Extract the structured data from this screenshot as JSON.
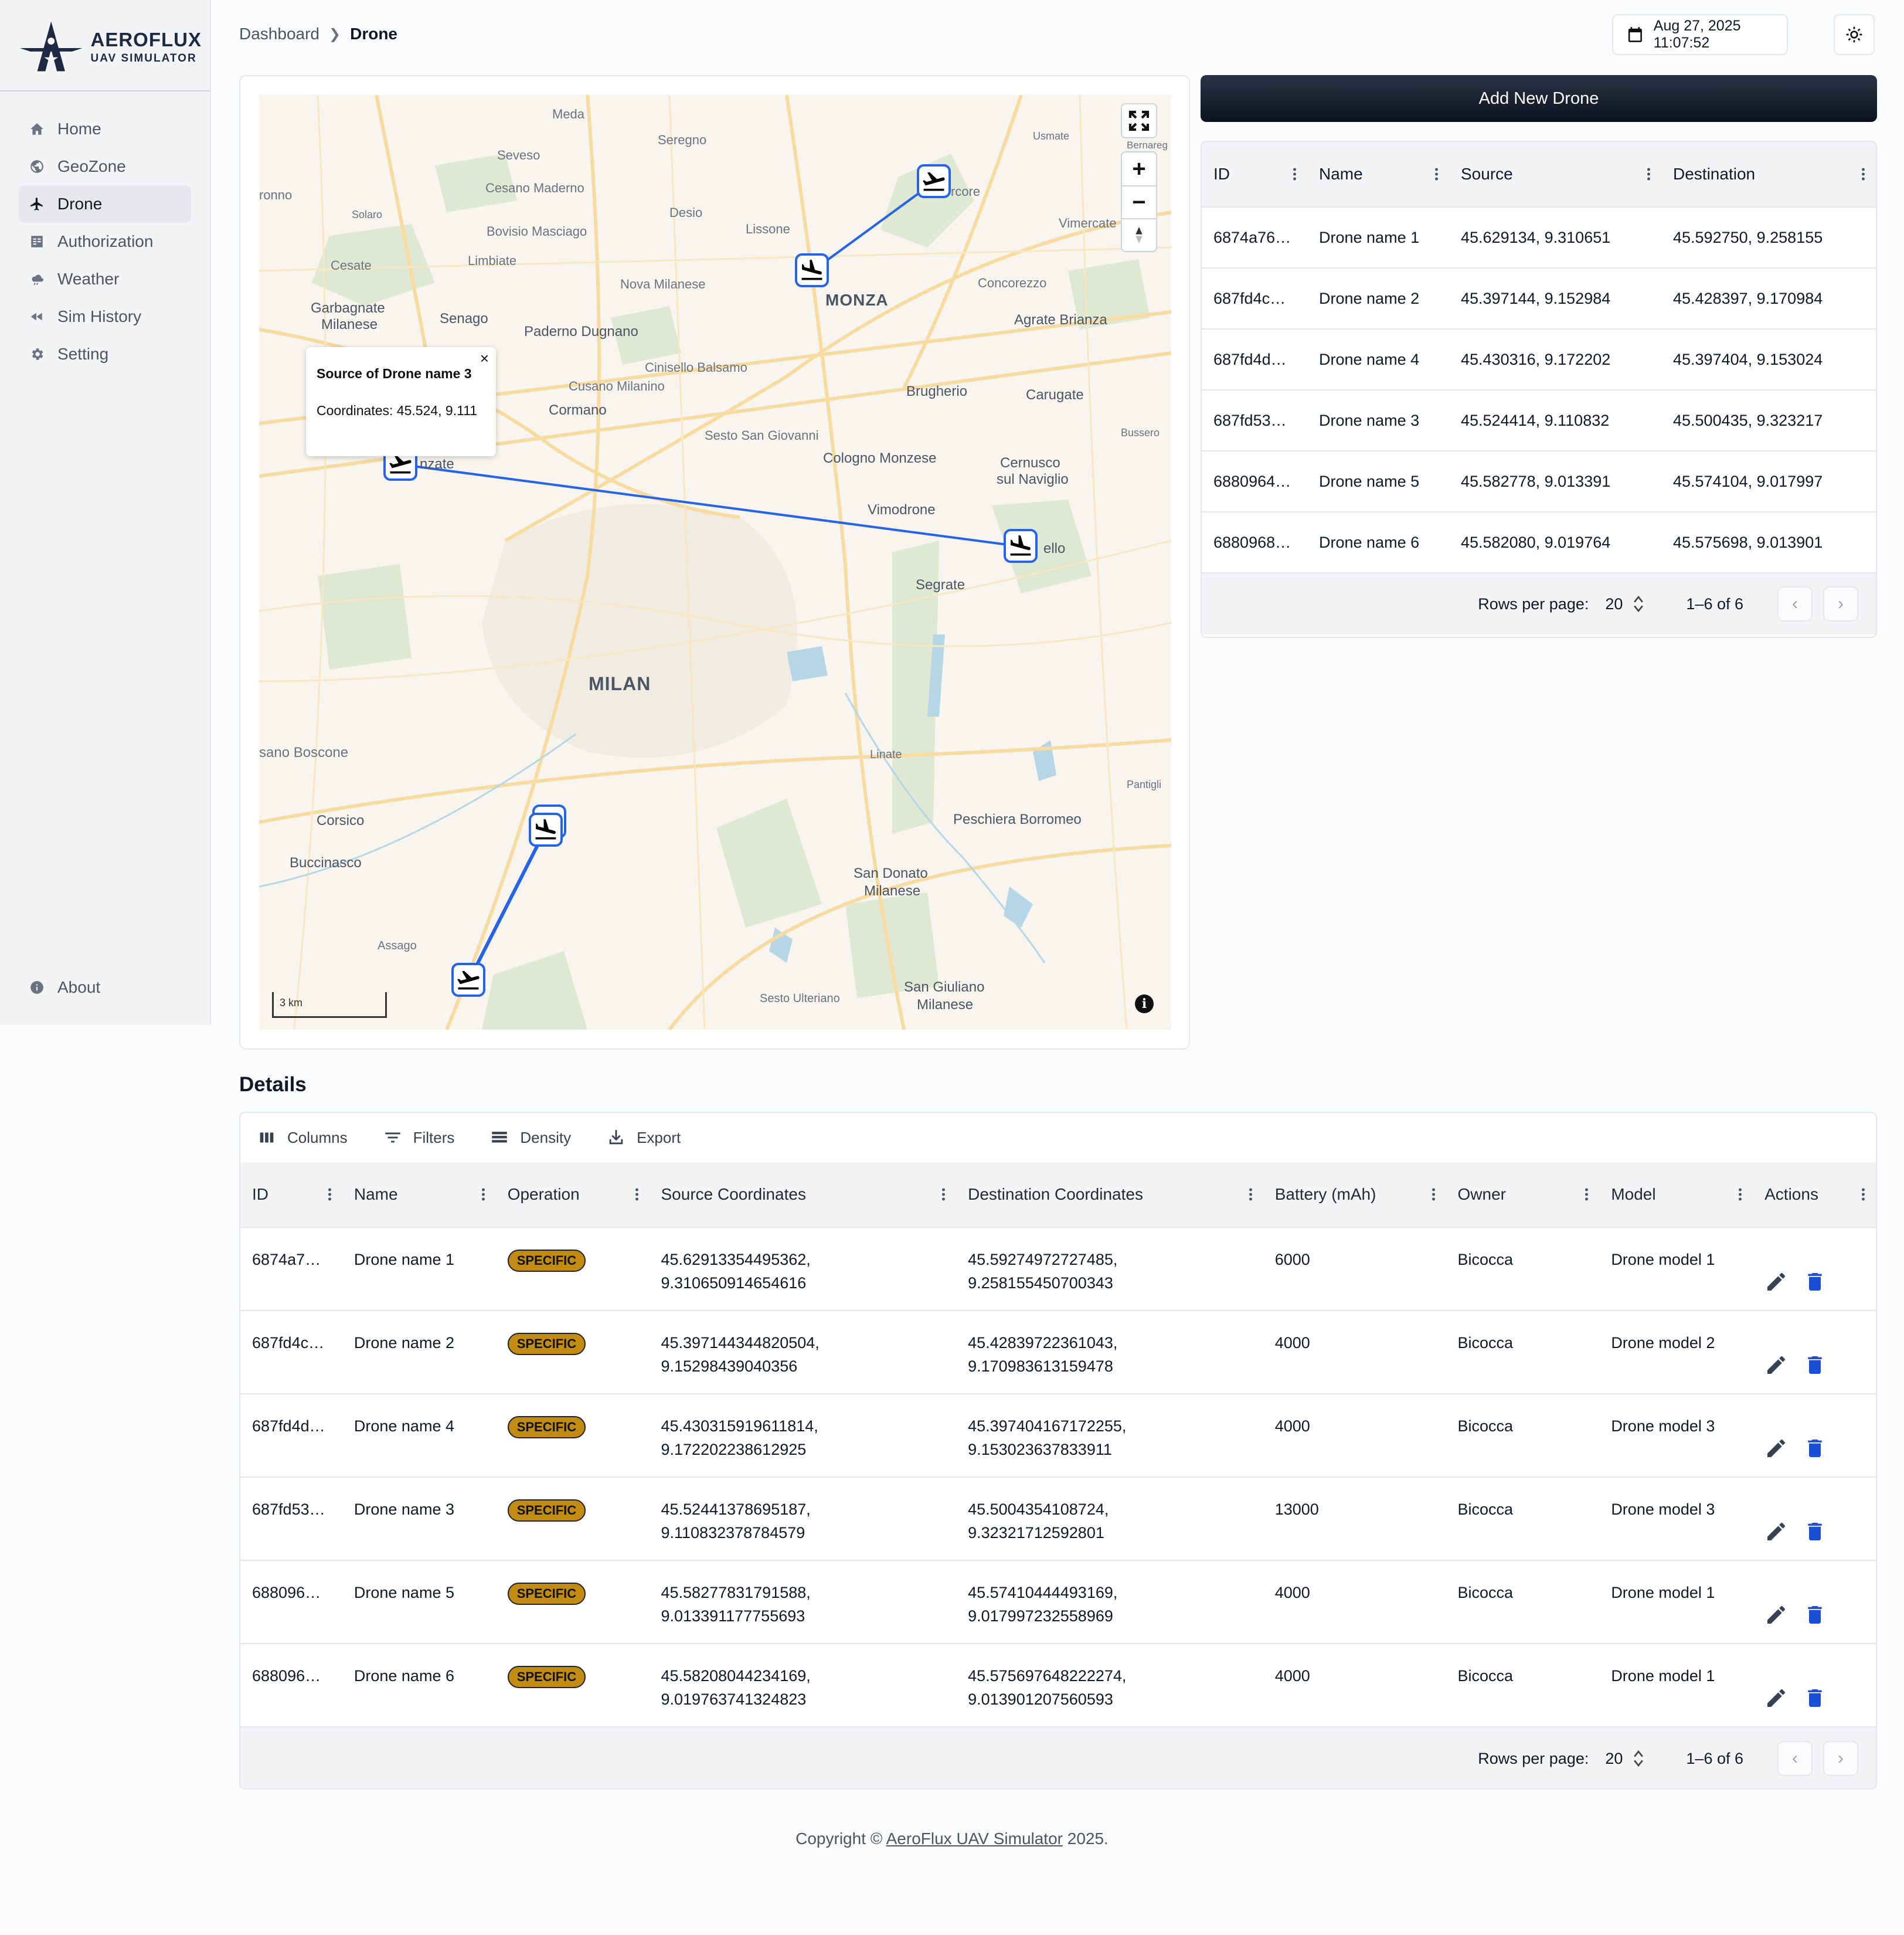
{
  "brand": {
    "name": "AEROFLUX",
    "subtitle": "UAV SIMULATOR"
  },
  "sidebar": {
    "items": [
      {
        "label": "Home",
        "icon": "home-icon"
      },
      {
        "label": "GeoZone",
        "icon": "globe-icon"
      },
      {
        "label": "Drone",
        "icon": "airplane-icon",
        "active": true
      },
      {
        "label": "Authorization",
        "icon": "clipboard-icon"
      },
      {
        "label": "Weather",
        "icon": "cloud-rain-icon"
      },
      {
        "label": "Sim History",
        "icon": "rewind-icon"
      },
      {
        "label": "Setting",
        "icon": "gear-icon"
      }
    ],
    "about": "About"
  },
  "header": {
    "breadcrumb": [
      "Dashboard",
      "Drone"
    ],
    "datetime": "Aug 27, 2025 11:07:52"
  },
  "map": {
    "places": [
      "Meda",
      "Seregno",
      "Usmate",
      "Seveso",
      "Bernareg",
      "ronno",
      "Cesano Maderno",
      "Desio",
      "rcore",
      "Solaro",
      "Bovisio Masciago",
      "Lissone",
      "Vimercate",
      "Limbiate",
      "Cesate",
      "Nova Milanese",
      "MONZA",
      "Concorezzo",
      "Garbagnate",
      "Milanese",
      "Senago",
      "Paderno Dugnano",
      "Agrate Brianza",
      "Cinisello Balsamo",
      "Cusano Milanino",
      "Brugherio",
      "Carugate",
      "Cormano",
      "Sesto San Giovanni",
      "Bussero",
      "nzate",
      "Cologno Monzese",
      "Cernusco",
      "sul Naviglio",
      "Vimodrone",
      "ello",
      "Segrate",
      "MILAN",
      "sano Boscone",
      "Linate",
      "Pantigli",
      "Corsico",
      "Peschiera Borromeo",
      "Buccinasco",
      "San Donato",
      "Milanese",
      "Assago",
      "Sesto Ulteriano",
      "San Giuliano",
      "Milanese"
    ],
    "popup": {
      "title": "Source of Drone name 3",
      "coordinates": "Coordinates: 45.524, 9.111",
      "close": "×"
    },
    "scale": "3 km",
    "info": "i",
    "accent": "#2563eb"
  },
  "add_button": "Add New Drone",
  "drone_table": {
    "columns": [
      "ID",
      "Name",
      "Source",
      "Destination"
    ],
    "rows": [
      [
        "6874a76…",
        "Drone name 1",
        "45.629134, 9.310651",
        "45.592750, 9.258155"
      ],
      [
        "687fd4c…",
        "Drone name 2",
        "45.397144, 9.152984",
        "45.428397, 9.170984"
      ],
      [
        "687fd4d…",
        "Drone name 4",
        "45.430316, 9.172202",
        "45.397404, 9.153024"
      ],
      [
        "687fd53…",
        "Drone name 3",
        "45.524414, 9.110832",
        "45.500435, 9.323217"
      ],
      [
        "6880964…",
        "Drone name 5",
        "45.582778, 9.013391",
        "45.574104, 9.017997"
      ],
      [
        "6880968…",
        "Drone name 6",
        "45.582080, 9.019764",
        "45.575698, 9.013901"
      ]
    ],
    "rows_per_page_label": "Rows per page:",
    "rows_per_page": "20",
    "range": "1–6 of 6"
  },
  "details": {
    "title": "Details",
    "toolbar": [
      "Columns",
      "Filters",
      "Density",
      "Export"
    ],
    "columns": [
      "ID",
      "Name",
      "Operation",
      "Source Coordinates",
      "Destination Coordinates",
      "Battery (mAh)",
      "Owner",
      "Model",
      "Actions"
    ],
    "rows": [
      [
        "6874a7…",
        "Drone name 1",
        "SPECIFIC",
        "45.62913354495362,",
        "9.310650914654616",
        "45.59274972727485,",
        "9.258155450700343",
        "6000",
        "Bicocca",
        "Drone model 1"
      ],
      [
        "687fd4c…",
        "Drone name 2",
        "SPECIFIC",
        "45.397144344820504,",
        "9.15298439040356",
        "45.42839722361043,",
        "9.170983613159478",
        "4000",
        "Bicocca",
        "Drone model 2"
      ],
      [
        "687fd4d…",
        "Drone name 4",
        "SPECIFIC",
        "45.430315919611814,",
        "9.172202238612925",
        "45.397404167172255,",
        "9.153023637833911",
        "4000",
        "Bicocca",
        "Drone model 3"
      ],
      [
        "687fd53…",
        "Drone name 3",
        "SPECIFIC",
        "45.52441378695187,",
        "9.110832378784579",
        "45.5004354108724,",
        "9.32321712592801",
        "13000",
        "Bicocca",
        "Drone model 3"
      ],
      [
        "688096…",
        "Drone name 5",
        "SPECIFIC",
        "45.58277831791588,",
        "9.013391177755693",
        "45.57410444493169,",
        "9.017997232558969",
        "4000",
        "Bicocca",
        "Drone model 1"
      ],
      [
        "688096…",
        "Drone name 6",
        "SPECIFIC",
        "45.58208044234169,",
        "9.019763741324823",
        "45.575697648222274,",
        "9.013901207560593",
        "4000",
        "Bicocca",
        "Drone model 1"
      ]
    ],
    "rows_per_page_label": "Rows per page:",
    "rows_per_page": "20",
    "range": "1–6 of 6"
  },
  "footer": {
    "prefix": "Copyright © ",
    "link": "AeroFlux UAV Simulator",
    "suffix": " 2025."
  },
  "colors": {
    "badge": "#c28b12",
    "action": "#1d4ed8",
    "edit": "#374151"
  }
}
